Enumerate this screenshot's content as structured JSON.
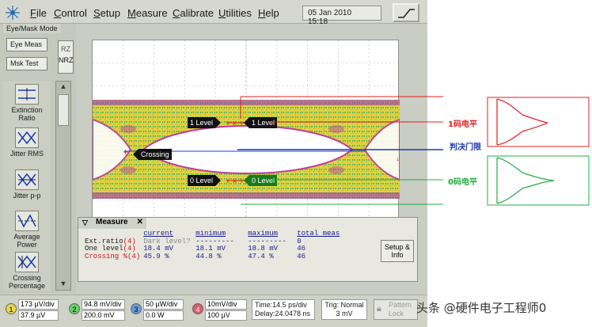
{
  "menubar": {
    "items": [
      "File",
      "Control",
      "Setup",
      "Measure",
      "Calibrate",
      "Utilities",
      "Help"
    ],
    "date": "05 Jan 2010",
    "time": "15:18"
  },
  "left_panel": {
    "mode_label": "Eye/Mask Mode",
    "eye_meas_label": "Eye Meas",
    "mask_test_label": "Msk Test",
    "rz_label": "RZ",
    "nrz_label": "NRZ",
    "tools": [
      {
        "icon": "extinction-ratio-icon",
        "label": "Extinction Ratio"
      },
      {
        "icon": "jitter-rms-icon",
        "label": "Jitter RMS"
      },
      {
        "icon": "jitter-pp-icon",
        "label": "Jitter p-p"
      },
      {
        "icon": "average-power-icon",
        "label": "Average Power"
      },
      {
        "icon": "crossing-percentage-icon",
        "label": "Crossing Percentage"
      }
    ]
  },
  "screen_markers": {
    "one_level_left": "1 Level",
    "one_level_right": "1 Level",
    "zero_level_left": "0 Level",
    "zero_level_right": "0 Level",
    "crossing": "Crossing"
  },
  "measure": {
    "tab_label": "Measure",
    "headers": [
      "current",
      "minimum",
      "maximum",
      "total meas"
    ],
    "rows": [
      {
        "label": "Ext.ratio",
        "ch": "(4)",
        "current": "Dark level?",
        "minimum": "---------",
        "maximum": "---------",
        "total": "0"
      },
      {
        "label": "One level",
        "ch": "(4)",
        "current": "18.4 mV",
        "minimum": "18.1 mV",
        "maximum": "18.8 mV",
        "total": "46"
      },
      {
        "label": "Crossing %",
        "ch": "(4)",
        "current": "45.9 %",
        "minimum": "44.8 %",
        "maximum": "47.4 %",
        "total": "46"
      }
    ],
    "setup_info_label": "Setup & Info"
  },
  "bottom": {
    "channels": [
      {
        "num": "1",
        "scale": "173 µV/div",
        "offset": "37.9 µV",
        "color": "#e8d84a"
      },
      {
        "num": "2",
        "scale": "94.8 mV/div",
        "offset": "200.0 mV",
        "color": "#6ad06a"
      },
      {
        "num": "3",
        "scale": "50 µW/div",
        "offset": "0.0 W",
        "color": "#6a9ad8"
      },
      {
        "num": "4",
        "scale": "10mV/div",
        "offset": "100 µV",
        "color": "#e05a6a"
      }
    ],
    "time_scale": "Time:14.5 ps/div",
    "delay": "Delay:24.0478 ns",
    "trig_mode": "Trig: Normal",
    "trig_level": "3 mV",
    "pattern_lock": "Pattern Lock"
  },
  "annotations": {
    "one_level": "1码电平",
    "threshold": "判决门限",
    "zero_level": "0码电平",
    "one_color": "#e02020",
    "threshold_color": "#1a3ab0",
    "zero_color": "#20b040"
  },
  "watermark": "头条 @硬件电子工程师0"
}
